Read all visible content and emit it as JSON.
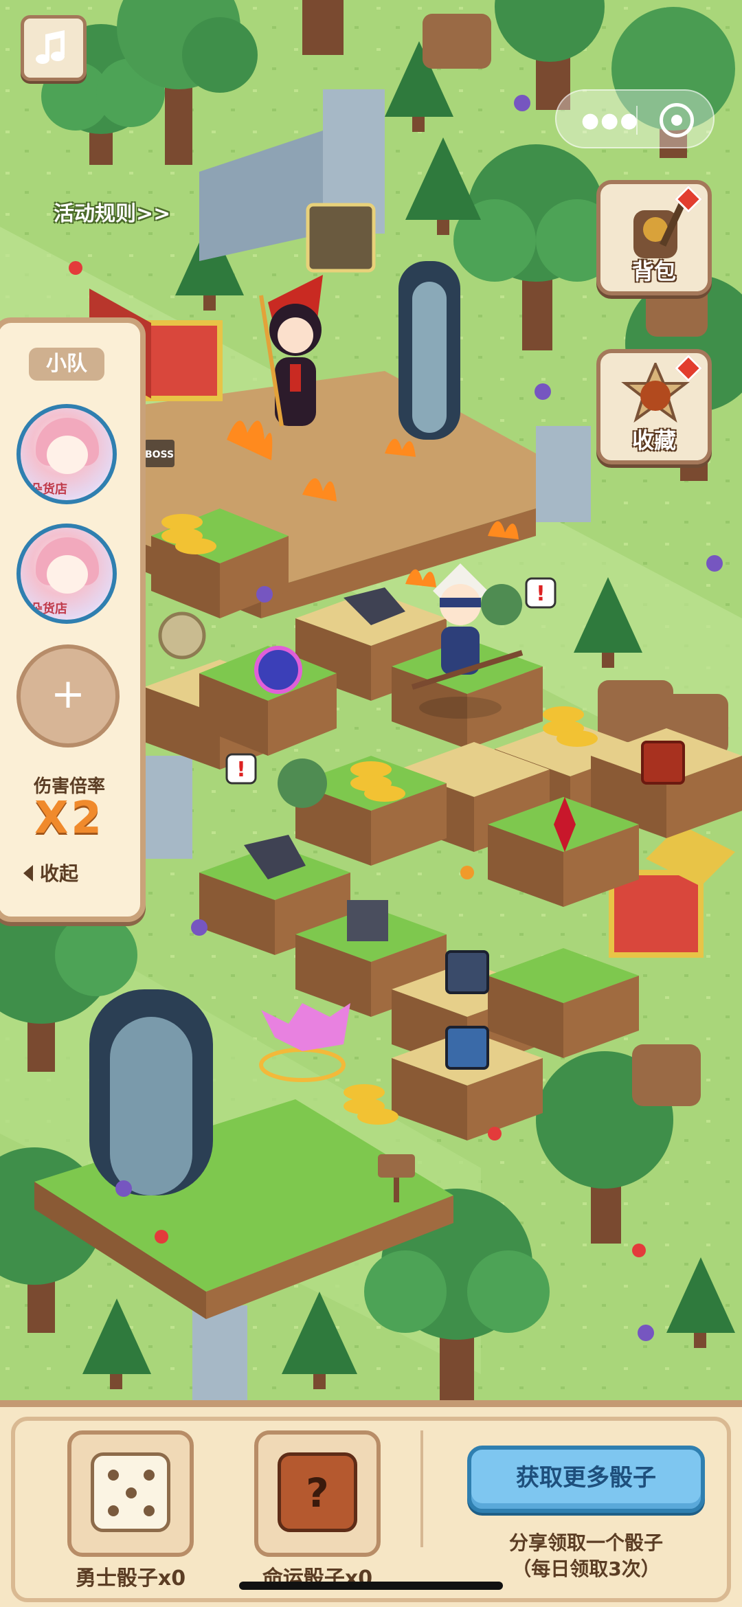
{
  "top": {
    "rules_link": "活动规则>>"
  },
  "side": {
    "backpack_label": "背包",
    "collection_label": "收藏"
  },
  "team": {
    "title": "小队",
    "members": [
      {
        "tag": "朵货店"
      },
      {
        "tag": "朵货店"
      }
    ],
    "add_label": "+",
    "damage_label": "伤害倍率",
    "damage_value": "X2",
    "collapse_label": "收起"
  },
  "board": {
    "boss_sign": "BOSS"
  },
  "bottom": {
    "warrior_dice_label": "勇士骰子x0",
    "fate_dice_label": "命运骰子x0",
    "get_more_label": "获取更多骰子",
    "share_text": "分享领取一个骰子",
    "share_sub": "（每日领取3次）"
  },
  "colors": {
    "grass": "#a9d67a",
    "panel": "#fbefd6",
    "panel_border": "#c9a27a",
    "accent_orange": "#f08a2c",
    "button_blue": "#7ec6f0"
  }
}
